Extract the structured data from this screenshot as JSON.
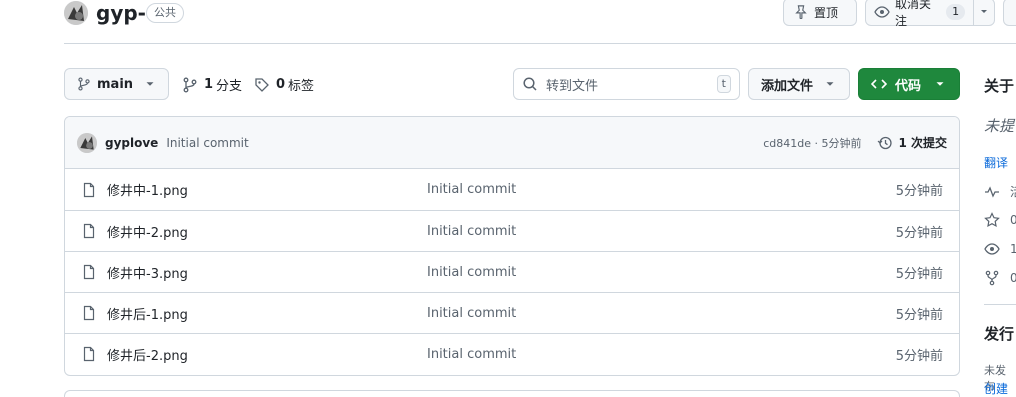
{
  "header": {
    "repo_name": "gyp-",
    "visibility_badge": "公共",
    "pin_label": "置顶",
    "watch_label": "取消关注",
    "watch_count": "1"
  },
  "toolbar": {
    "branch": "main",
    "branches_count": "1",
    "branches_label": "分支",
    "tags_count": "0",
    "tags_label": "标签",
    "search_placeholder": "转到文件",
    "search_shortcut": "t",
    "add_file_label": "添加文件",
    "code_label": "代码"
  },
  "latest_commit": {
    "author": "gyplove",
    "message": "Initial commit",
    "meta": "cd841de · 5分钟前",
    "history_label": "1 次提交"
  },
  "files": [
    {
      "name": "修井中-1.png",
      "message": "Initial commit",
      "time": "5分钟前"
    },
    {
      "name": "修井中-2.png",
      "message": "Initial commit",
      "time": "5分钟前"
    },
    {
      "name": "修井中-3.png",
      "message": "Initial commit",
      "time": "5分钟前"
    },
    {
      "name": "修井后-1.png",
      "message": "Initial commit",
      "time": "5分钟前"
    },
    {
      "name": "修井后-2.png",
      "message": "Initial commit",
      "time": "5分钟前"
    }
  ],
  "sidebar": {
    "about_title": "关于",
    "description_partial": "未提",
    "translate_link": "翻译",
    "activity_partial": "活",
    "stars_partial": "0",
    "watchers_partial": "1",
    "forks_partial": "0",
    "releases_title": "发行",
    "releases_note": "未发布",
    "create_link": "创建发"
  },
  "colors": {
    "accent_green": "#1f883d",
    "link_blue": "#0969da",
    "border": "#d0d7de"
  }
}
